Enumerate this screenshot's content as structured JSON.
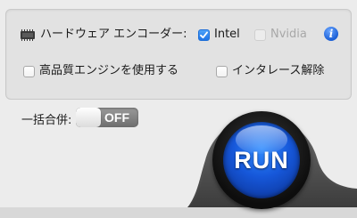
{
  "encoder": {
    "label": "ハードウェア エンコーダー:",
    "intel_label": "Intel",
    "intel_checked": true,
    "nvidia_label": "Nvidia",
    "nvidia_checked": false,
    "nvidia_enabled": false,
    "info_glyph": "i"
  },
  "options": {
    "high_quality_label": "高品質エンジンを使用する",
    "high_quality_checked": false,
    "deinterlace_label": "インタレース解除",
    "deinterlace_checked": false
  },
  "merge": {
    "label": "一括合併:",
    "toggle_text": "OFF",
    "toggle_on": false
  },
  "run": {
    "label": "RUN"
  },
  "colors": {
    "accent": "#1f74e6",
    "run_blue": "#1657d9",
    "info_blue": "#1b5fd6"
  }
}
